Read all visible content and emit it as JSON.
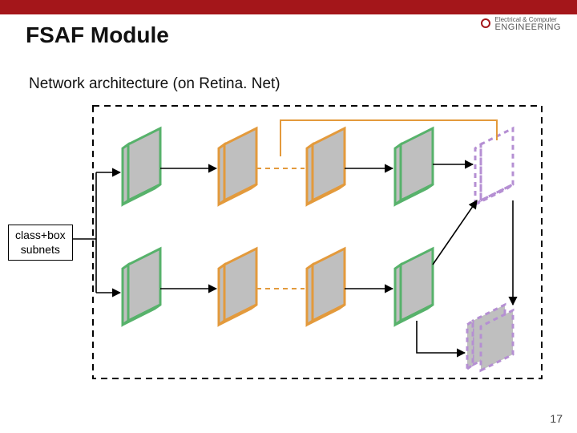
{
  "title": "FSAF Module",
  "subtitle": "Network architecture (on Retina. Net)",
  "department": {
    "line1": "Electrical & Computer",
    "line2": "ENGINEERING"
  },
  "label": {
    "line1": "class+box",
    "line2": "subnets"
  },
  "page_number": "17",
  "colors": {
    "titlebar": "#a4161a",
    "block_fill": "#bfbfbf",
    "green": "#57b26b",
    "orange": "#e39a3c",
    "purple": "#b58fd3",
    "dash_border": "#000000"
  },
  "chart_data": {
    "type": "diagram",
    "description": "FSAF module on RetinaNet: shared class+box subnets feeding two parallel rows. Each row has an input block (green border), two conv blocks (orange border), an output block (green border). Anchor-free branch head (purple dashed) attaches after middle conv blocks. A second purple dashed head cluster sits at bottom-right fed from second-row output.",
    "rows": [
      {
        "name": "top_row",
        "blocks": [
          "input_green",
          "conv_orange",
          "conv_orange",
          "output_green"
        ],
        "extra_head": {
          "after_block": 2,
          "type": "purple_dashed",
          "via": [
            "up_then_right_from_block2",
            "arrow_from_output_green"
          ]
        }
      },
      {
        "name": "bottom_row",
        "blocks": [
          "input_green",
          "conv_orange",
          "conv_orange",
          "output_green"
        ],
        "extra_head": {
          "from": "output_green",
          "type": "purple_dashed_cluster_bottom_right"
        }
      }
    ],
    "shared_input": "class+box subnets (label) feeds both rows via solid arrows",
    "outer_container": "large dashed rectangle around everything",
    "connection_styles": {
      "input_to_first_conv": "solid_arrow",
      "between_conv_blocks": "dashed_orange",
      "last_conv_to_output": "solid_arrow",
      "to_purple_heads": "solid_arrow"
    }
  }
}
